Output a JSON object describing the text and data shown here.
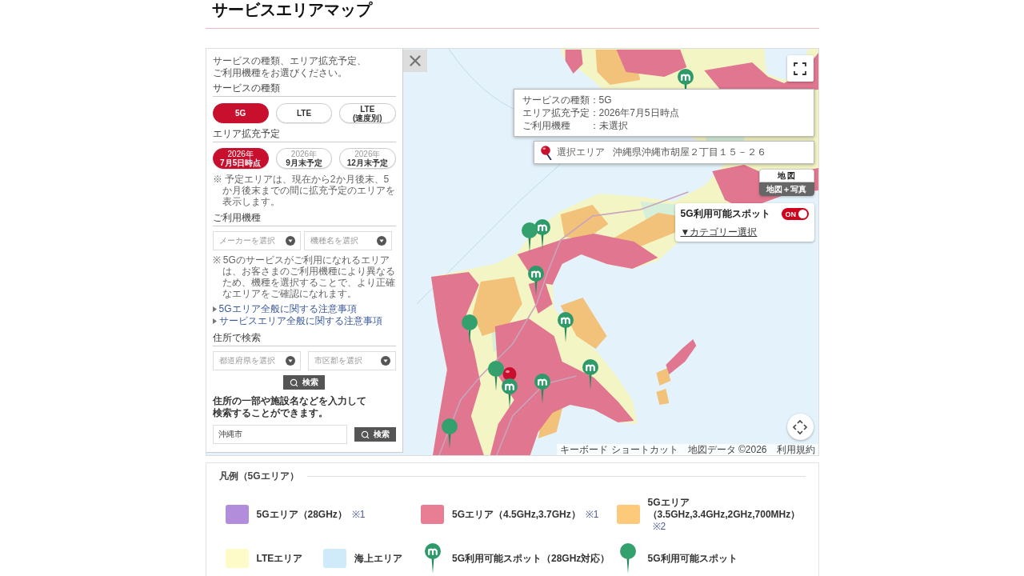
{
  "page_title": "サービスエリアマップ",
  "panel": {
    "intro": "サービスの種類、エリア拡充予定、ご利用機種をお選びください。",
    "service_type": {
      "heading": "サービスの種類",
      "options": [
        {
          "lines": [
            "5G"
          ],
          "selected": true
        },
        {
          "lines": [
            "LTE"
          ],
          "selected": false
        },
        {
          "lines": [
            "LTE",
            "(速度別)"
          ],
          "selected": false
        }
      ]
    },
    "area_expansion": {
      "heading": "エリア拡充予定",
      "options": [
        {
          "lines": [
            "2026年",
            "7月5日時点"
          ],
          "selected": true
        },
        {
          "lines": [
            "2026年",
            "9月末予定"
          ],
          "selected": false
        },
        {
          "lines": [
            "2026年",
            "12月末予定"
          ],
          "selected": false
        }
      ],
      "note": "※ 予定エリアは、現在から2か月後末、5か月後末までの間に拡充予定のエリアを表示します。"
    },
    "device": {
      "heading": "ご利用機種",
      "selects": [
        {
          "placeholder": "メーカーを選択"
        },
        {
          "placeholder": "機種名を選択"
        }
      ],
      "note": "※ 5Gのサービスがご利用になれるエリアは、お客さまのご利用機種により異なるため、機種を選択することで、より正確なエリアをご確認になれます。"
    },
    "links": [
      "5Gエリア全般に関する注意事項",
      "サービスエリア全般に関する注意事項"
    ],
    "address_search": {
      "heading": "住所で検索",
      "selects": [
        {
          "placeholder": "都道府県を選択"
        },
        {
          "placeholder": "市区郡を選択"
        }
      ],
      "button": "検索",
      "hint": "住所の一部や施設名などを入力して検索することができます。",
      "input": {
        "value": "沖縄市"
      },
      "input_button": "検索"
    }
  },
  "map": {
    "info": [
      {
        "label": "サービスの種類",
        "separator": "：",
        "value": "5G"
      },
      {
        "label": "エリア拡充予定",
        "separator": "：",
        "value": "2026年7月5日時点"
      },
      {
        "label": "ご利用機種",
        "separator": "：",
        "value": "未選択"
      }
    ],
    "selected_area": {
      "label": "選択エリア",
      "address": "沖縄県沖縄市胡屋２丁目１５－２６"
    },
    "map_types": [
      {
        "label": "地 図",
        "selected": true
      },
      {
        "label": "地図＋写真",
        "selected": false
      }
    ],
    "spot_panel": {
      "title": "5G利用可能スポット",
      "toggle": {
        "label": "ON",
        "on": true
      },
      "category_link": "▼カテゴリー選択"
    },
    "spots": [
      {
        "kind": "spot28"
      },
      {
        "kind": "spot28"
      },
      {
        "kind": "spot"
      },
      {
        "kind": "spot28"
      },
      {
        "kind": "spot28"
      },
      {
        "kind": "spot"
      },
      {
        "kind": "spot28"
      },
      {
        "kind": "spot"
      },
      {
        "kind": "spot28"
      },
      {
        "kind": "spot28"
      },
      {
        "kind": "spot"
      }
    ],
    "attribution": [
      "キーボード ショートカット",
      "地図データ ©2026",
      "利用規約"
    ]
  },
  "legend": {
    "title": "凡例（5Gエリア）",
    "rows": [
      {
        "cells": [
          {
            "items": [
              {
                "kind": "swatch",
                "color": "#b28ddc",
                "label": "5Gエリア（28GHz）",
                "note": "※1"
              }
            ]
          },
          {
            "items": [
              {
                "kind": "swatch",
                "color": "#e87e93",
                "label": "5Gエリア（4.5GHz,3.7GHz）",
                "note": "※1"
              }
            ]
          },
          {
            "items": [
              {
                "kind": "swatch",
                "color": "#fdc97a",
                "label": "5Gエリア（3.5GHz,3.4GHz,2GHz,700MHz）",
                "note": "※2"
              }
            ]
          }
        ]
      },
      {
        "cells": [
          {
            "items": [
              {
                "kind": "swatch",
                "color": "#fdfbc8",
                "label": "LTEエリア"
              },
              {
                "kind": "swatch",
                "color": "#cfeaf8",
                "label": "海上エリア"
              }
            ]
          },
          {
            "items": [
              {
                "kind": "spot28",
                "label": "5G利用可能スポット（28GHz対応）"
              }
            ]
          },
          {
            "items": [
              {
                "kind": "spot",
                "label": "5G利用可能スポット"
              }
            ]
          }
        ]
      }
    ]
  }
}
